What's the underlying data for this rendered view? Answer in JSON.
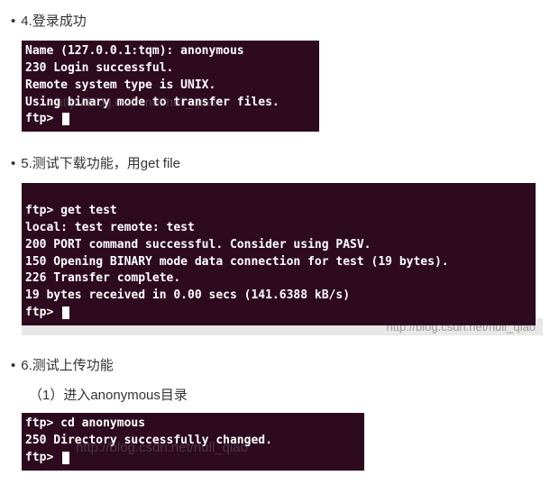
{
  "steps": {
    "s4": {
      "bullet": "•",
      "title": "4.登录成功"
    },
    "s5": {
      "bullet": "•",
      "title": "5.测试下载功能，用get file"
    },
    "s6": {
      "bullet": "•",
      "title": "6.测试上传功能",
      "sub1": "（1）进入anonymous目录"
    }
  },
  "terminal1": {
    "l1": "Name (127.0.0.1:tqm): anonymous",
    "l2": "230 Login successful.",
    "l3": "Remote system type is UNIX.",
    "l4": "Using binary mode to transfer files.",
    "prompt": "ftp>"
  },
  "terminal2": {
    "l1": "ftp> get test",
    "l2": "local: test remote: test",
    "l3": "200 PORT command successful. Consider using PASV.",
    "l4": "150 Opening BINARY mode data connection for test (19 bytes).",
    "l5": "226 Transfer complete.",
    "l6": "19 bytes received in 0.00 secs (141.6388 kB/s)",
    "prompt": "ftp>"
  },
  "terminal3": {
    "l1": "ftp> cd anonymous",
    "l2": "250 Directory successfully changed.",
    "prompt": "ftp>"
  },
  "watermarks": {
    "w1": "http://blog.csdn.net/null_qiao",
    "w2": "http://blog.csdn.net/null_qiao",
    "w3": "http://blog.csdn.net/null_qiao"
  }
}
